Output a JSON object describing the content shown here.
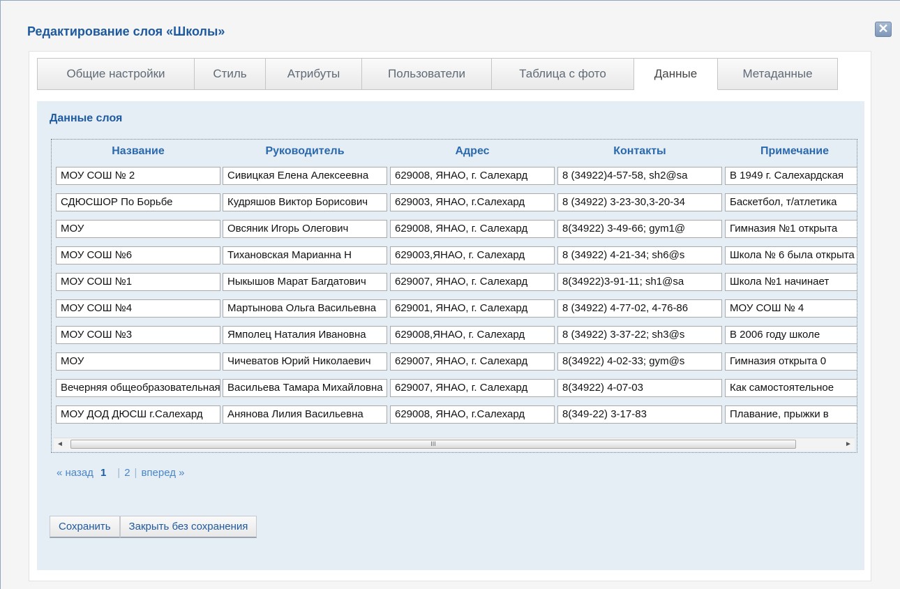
{
  "dialog": {
    "title": "Редактирование слоя «Школы»",
    "close_icon": "close-icon"
  },
  "tabs": [
    {
      "label": "Общие настройки",
      "active": false
    },
    {
      "label": "Стиль",
      "active": false
    },
    {
      "label": "Атрибуты",
      "active": false
    },
    {
      "label": "Пользователи",
      "active": false
    },
    {
      "label": "Таблица с фото",
      "active": false
    },
    {
      "label": "Данные",
      "active": true
    },
    {
      "label": "Метаданные",
      "active": false
    }
  ],
  "section_title": "Данные слоя",
  "table": {
    "columns": [
      "Название",
      "Руководитель",
      "Адрес",
      "Контакты",
      "Примечание"
    ],
    "rows": [
      [
        "МОУ СОШ № 2",
        "Сивицкая Елена Алексеевна",
        "629008, ЯНАО, г. Салехард",
        "8 (34922)4-57-58, sh2@sa",
        "В 1949 г. Салехардская"
      ],
      [
        "СДЮСШОР По Борьбе",
        "Кудряшов Виктор Борисович",
        "629003, ЯНАО,  г.Салехард",
        "8 (34922) 3-23-30,3-20-34",
        "Баскетбол, т/атлетика"
      ],
      [
        "МОУ",
        "Овсяник Игорь Олегович",
        "629008, ЯНАО, г. Салехард",
        "8(34922) 3-49-66;  gym1@",
        "Гимназия №1 открыта"
      ],
      [
        "МОУ СОШ №6",
        "Тихановская Марианна Н",
        "629003,ЯНАО, г. Салехард",
        "8 (34922) 4-21-34;  sh6@s",
        "Школа № 6 была открыта"
      ],
      [
        "МОУ СОШ №1",
        "Ныкышов Марат Багдатович",
        "629007, ЯНАО, г. Салехард",
        "8(34922)3-91-11; sh1@sa",
        "Школа №1 начинает"
      ],
      [
        "МОУ СОШ №4",
        "Мартынова Ольга Васильевна",
        "629001, ЯНАО, г. Салехард",
        "8 (34922) 4-77-02, 4-76-86",
        "МОУ СОШ № 4"
      ],
      [
        "МОУ СОШ №3",
        "Ямполец Наталия Ивановна",
        "629008,ЯНАО, г. Салехард",
        "8 (34922) 3-37-22; sh3@s",
        "В 2006 году школе"
      ],
      [
        "МОУ",
        "Чичеватов Юрий Николаевич",
        "629007, ЯНАО, г. Салехард",
        "8(34922) 4-02-33;  gym@s",
        "Гимназия открыта 0"
      ],
      [
        "Вечерняя общеобразовательная",
        "Васильева Тамара Михайловна",
        "629007, ЯНАО, г. Салехард",
        "8(34922) 4-07-03",
        "Как самостоятельное"
      ],
      [
        "МОУ ДОД ДЮСШ г.Салехард",
        "Анянова Лилия Васильевна",
        "629008, ЯНАО, г.Салехард",
        "8(349-22) 3-17-83",
        "Плавание, прыжки в"
      ]
    ]
  },
  "scrollbar": {
    "thumb_grip": "III",
    "left_arrow": "◄",
    "right_arrow": "►"
  },
  "pager": {
    "prev": "« назад",
    "pages": [
      "1",
      "2"
    ],
    "current": "1",
    "next": "вперед »"
  },
  "buttons": {
    "save": "Сохранить",
    "close_no_save": "Закрыть без сохранения"
  }
}
